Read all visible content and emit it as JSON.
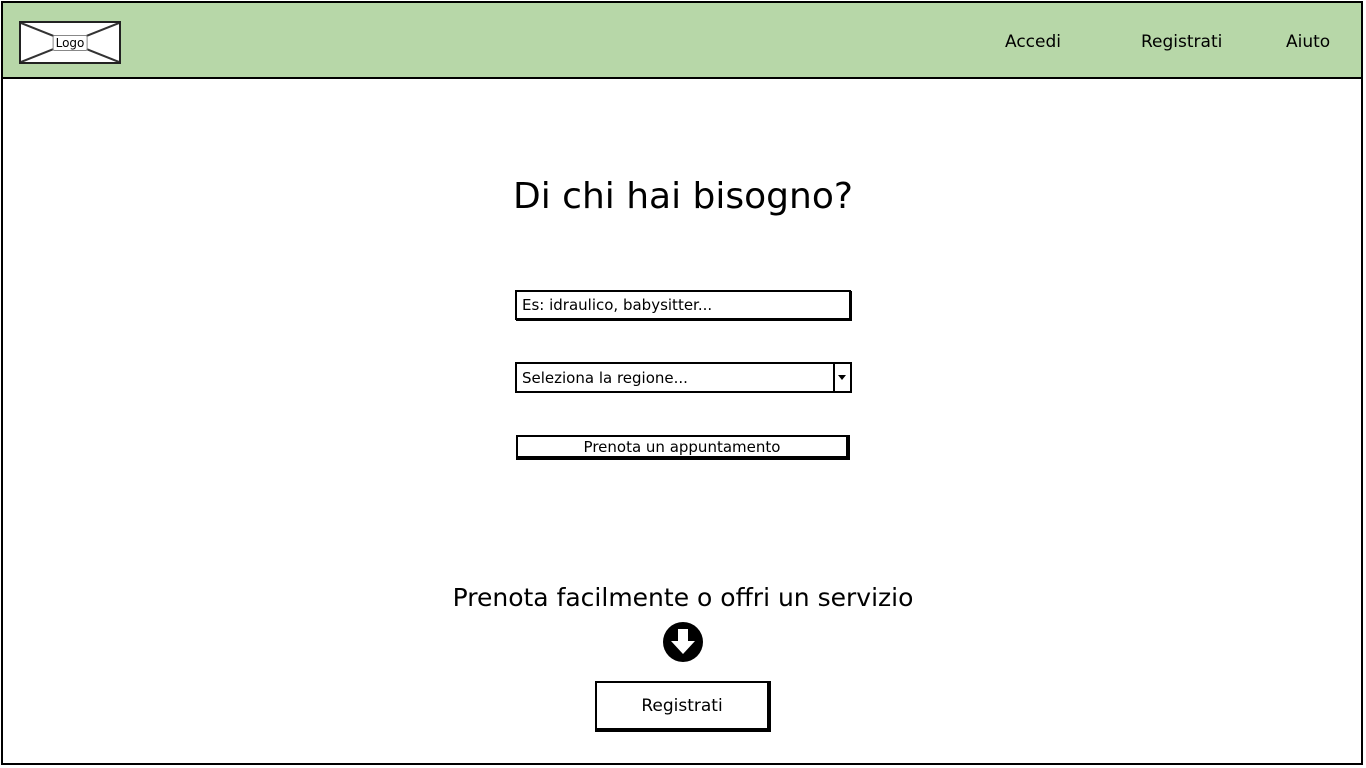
{
  "header": {
    "logo_label": "Logo",
    "nav": {
      "accedi": "Accedi",
      "registrati": "Registrati",
      "aiuto": "Aiuto"
    },
    "background_color": "#b7d7a8"
  },
  "main": {
    "headline": "Di chi hai bisogno?",
    "search": {
      "placeholder": "Es: idraulico, babysitter...",
      "value": ""
    },
    "region_select": {
      "selected": "Seleziona la regione..."
    },
    "appointment_button": "Prenota un appuntamento",
    "subheadline": "Prenota facilmente o offri un servizio",
    "register_button": "Registrati"
  },
  "icons": {
    "logo": "image-placeholder-icon",
    "down": "arrow-down-circle-icon",
    "dropdown": "chevron-down-icon"
  }
}
